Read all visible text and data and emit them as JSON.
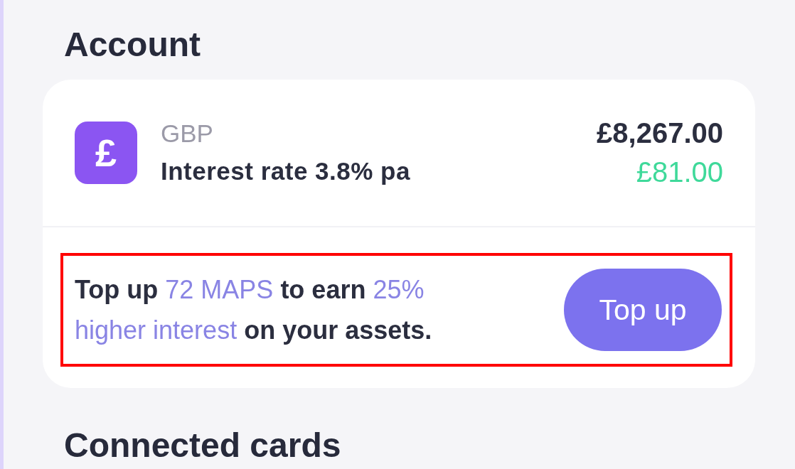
{
  "account": {
    "title": "Account",
    "icon": "£",
    "currency": "GBP",
    "interest_rate": "Interest rate 3.8% pa",
    "balance": "£8,267.00",
    "interest_earned": "£81.00",
    "promo": {
      "highlighted": true,
      "message": [
        {
          "text": "Top up ",
          "accent": false
        },
        {
          "text": "72 MAPS",
          "accent": true
        },
        {
          "text": " to earn ",
          "accent": false
        },
        {
          "text": "25% higher interest",
          "accent": true
        },
        {
          "text": " on your assets.",
          "accent": false
        }
      ],
      "button": "Top up"
    }
  },
  "connected_cards": {
    "title": "Connected cards"
  }
}
